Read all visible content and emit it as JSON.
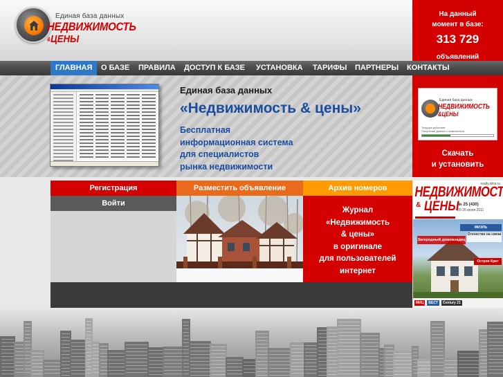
{
  "header": {
    "logo": {
      "tagline": "Единая база данных",
      "name": "НЕДВИЖИМОСТЬ",
      "amp": "&",
      "name2": "ЦЕНЫ"
    },
    "counter": {
      "line1": "На данный",
      "line2": "момент в базе:",
      "count": "313 729",
      "unit": "объявлений"
    }
  },
  "nav": {
    "items": [
      {
        "label": "ГЛАВНАЯ",
        "active": true
      },
      {
        "label": "О БАЗЕ"
      },
      {
        "label": "ПРАВИЛА"
      },
      {
        "label": "ДОСТУП К БАЗЕ"
      },
      {
        "label": "УСТАНОВКА"
      },
      {
        "label": "ТАРИФЫ"
      },
      {
        "label": "ПАРТНЕРЫ"
      },
      {
        "label": "КОНТАКТЫ"
      }
    ],
    "active_color": "#2e78c8"
  },
  "banner": {
    "title": "Единая база данных",
    "name": "«Недвижимость & цены»",
    "desc": [
      "Бесплатная",
      "информационная система",
      "для специалистов",
      "рынка недвижимости"
    ]
  },
  "download": {
    "logo_tagline": "Единая база данных",
    "logo_name": "НЕДВИЖИМОСТЬ",
    "logo_name2": "&ЦЕНЫ",
    "line1": "Текущее действие:",
    "line2": "Получение данных с компьютера",
    "label_line1": "Скачать",
    "label_line2": "и установить"
  },
  "actions": {
    "register": "Регистрация",
    "login": "Войти",
    "post_ad": "Разместить объявление",
    "archive": "Архив номеров"
  },
  "journal": {
    "lines": [
      "Журнал",
      "«Недвижимость",
      "& цены»",
      "в оригинале",
      "для пользователей",
      "интернет"
    ]
  },
  "magazine": {
    "title": "НЕДВИЖИМОСТЬ",
    "amp": "&",
    "title2": "ЦЕНЫ",
    "url": "realty.dmir.ru",
    "issue": "№ 25 (430)",
    "date": "20-26 июня 2011",
    "badge1": "МИЭЛЬ",
    "badge2": "Загородный домовладец",
    "badge3": "Отечество на связи",
    "badge4": "Остров Крит",
    "footer": [
      "МИЦ",
      "БЕСТ",
      "Century 21"
    ]
  },
  "colors": {
    "brand_red": "#d40000",
    "orange": "#e86a1a",
    "amber": "#ff9a00",
    "blue_text": "#1a4da0"
  }
}
